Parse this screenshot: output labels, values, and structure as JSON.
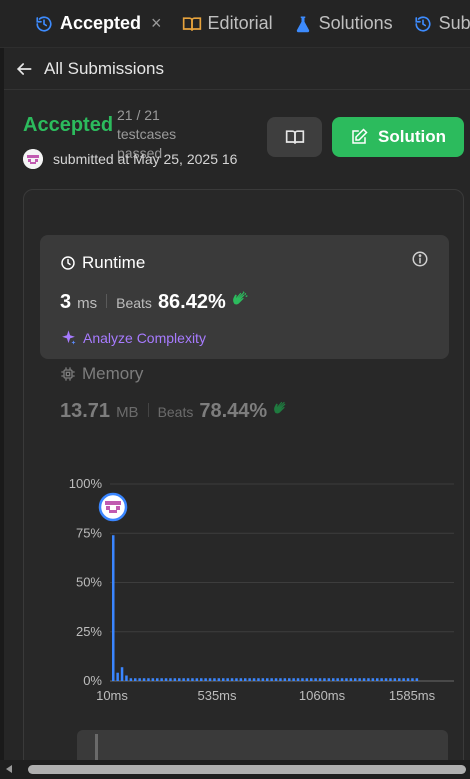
{
  "tabs": [
    {
      "label": "Accepted",
      "icon": "history-icon",
      "active": true
    },
    {
      "label": "Editorial",
      "icon": "book-icon",
      "active": false
    },
    {
      "label": "Solutions",
      "icon": "flask-icon",
      "active": false
    },
    {
      "label": "Subm",
      "icon": "history-icon",
      "active": false
    }
  ],
  "close_label": "×",
  "back_label": "All Submissions",
  "status": "Accepted",
  "testcases": "21 / 21 testcases passed",
  "submitted": "submitted at May 25, 2025 16",
  "solution_button": "Solution",
  "runtime": {
    "title": "Runtime",
    "value": "3",
    "unit": "ms",
    "beats_label": "Beats",
    "percent": "86.42%",
    "analyze_label": "Analyze Complexity"
  },
  "memory": {
    "title": "Memory",
    "value": "13.71",
    "unit": "MB",
    "beats_label": "Beats",
    "percent": "78.44%"
  },
  "colors": {
    "accent_green": "#2cbb5d",
    "bar_blue": "#3a86ff",
    "analyze_purple": "#a77bff",
    "tab_blue": "#3d8bfd",
    "editorial_orange": "#e6a23c"
  },
  "chart_data": {
    "type": "bar",
    "y_ticks": [
      "100%",
      "75%",
      "50%",
      "25%",
      "0%"
    ],
    "x_ticks": [
      "10ms",
      "535ms",
      "1060ms",
      "1585ms"
    ],
    "x": [
      10,
      20,
      30,
      40,
      50,
      60,
      70,
      80
    ],
    "values": [
      74,
      3,
      7,
      2,
      1,
      1,
      1,
      1
    ],
    "tail_bar_count": 62,
    "tail_value": 1,
    "ylim": [
      0,
      100
    ],
    "grid": true,
    "marker_at": "10ms"
  }
}
